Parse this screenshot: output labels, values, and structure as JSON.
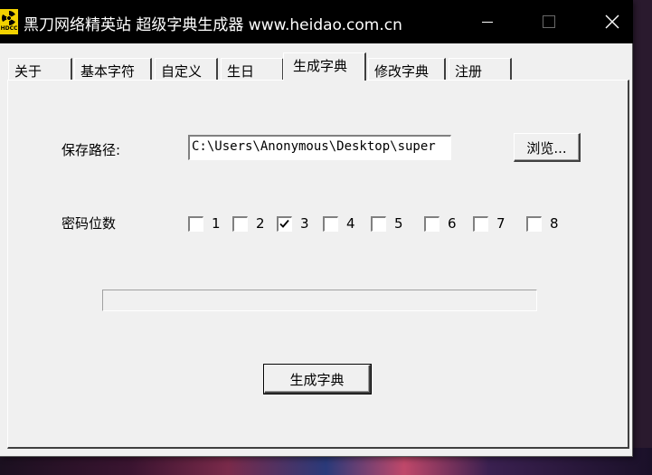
{
  "window": {
    "title": "黑刀网络精英站 超级字典生成器 www.heidao.com.cn",
    "icon_text": "HDCC"
  },
  "tabs": [
    {
      "label": "关于",
      "active": false
    },
    {
      "label": "基本字符",
      "active": false
    },
    {
      "label": "自定义",
      "active": false
    },
    {
      "label": "生日",
      "active": false
    },
    {
      "label": "生成字典",
      "active": true
    },
    {
      "label": "修改字典",
      "active": false
    },
    {
      "label": "注册",
      "active": false
    }
  ],
  "main": {
    "save_path_label": "保存路径:",
    "save_path_value": "C:\\Users\\Anonymous\\Desktop\\super",
    "browse_label": "浏览...",
    "digits_label": "密码位数",
    "digits": [
      {
        "label": "1",
        "checked": false
      },
      {
        "label": "2",
        "checked": false
      },
      {
        "label": "3",
        "checked": true
      },
      {
        "label": "4",
        "checked": false
      },
      {
        "label": "5",
        "checked": false
      },
      {
        "label": "6",
        "checked": false
      },
      {
        "label": "7",
        "checked": false
      },
      {
        "label": "8",
        "checked": false
      }
    ],
    "progress": 0,
    "generate_label": "生成字典"
  },
  "colors": {
    "titlebar": "#000000",
    "window_bg": "#f0f0f0"
  }
}
